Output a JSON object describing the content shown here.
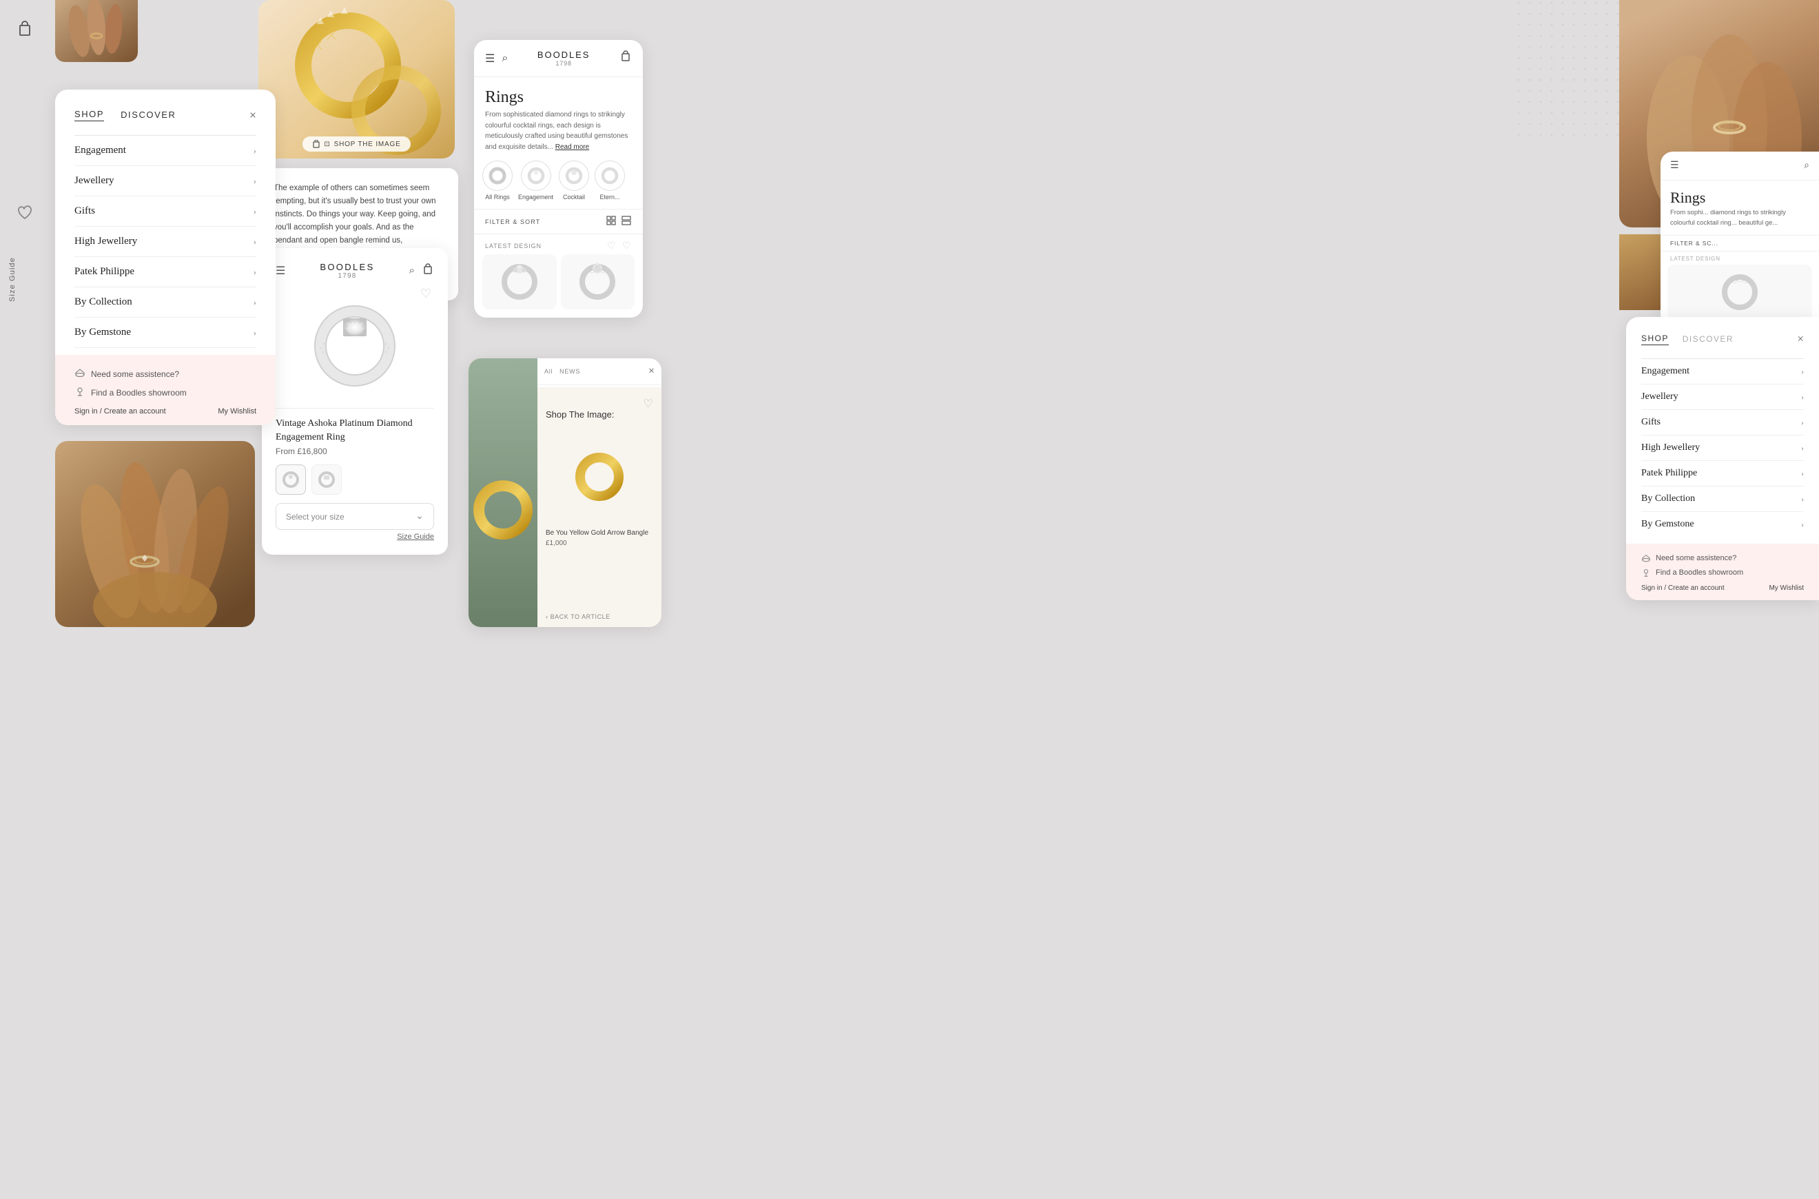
{
  "brand": {
    "name": "BOODLES",
    "year": "1798"
  },
  "nav": {
    "shop_label": "SHOP",
    "discover_label": "DISCOVER",
    "close_label": "×",
    "items": [
      {
        "label": "Engagement",
        "id": "engagement"
      },
      {
        "label": "Jewellery",
        "id": "jewellery"
      },
      {
        "label": "Gifts",
        "id": "gifts"
      },
      {
        "label": "High Jewellery",
        "id": "high-jewellery"
      },
      {
        "label": "Patek Philippe",
        "id": "patek-philippe"
      },
      {
        "label": "By Collection",
        "id": "by-collection"
      },
      {
        "label": "By Gemstone",
        "id": "by-gemstone"
      }
    ],
    "footer": {
      "assistance": "Need some assistence?",
      "showroom": "Find a Boodles showroom",
      "sign_in": "Sign in / Create an account",
      "wishlist": "My Wishlist"
    }
  },
  "nav2": {
    "shop_label": "SHOP",
    "discover_label": "DISCOVER",
    "close_label": "×",
    "items": [
      {
        "label": "Engagement"
      },
      {
        "label": "Jewellery"
      },
      {
        "label": "Gifts"
      },
      {
        "label": "High Jewellery"
      },
      {
        "label": "Patek Philippe"
      },
      {
        "label": "By Collection"
      },
      {
        "label": "By Gemstone"
      }
    ],
    "footer": {
      "assistance": "Need some assistence?",
      "showroom": "Find a Boodles showroom",
      "sign_in": "Sign in / Create an account",
      "wishlist": "My Wishlist"
    }
  },
  "rings_page": {
    "heading": "Rings",
    "description": "From sophisticated diamond rings to strikingly colourful cocktail rings, each design is meticulously crafted using beautiful gemstones and exquisite details...",
    "read_more": "Read more",
    "filter_label": "FILTER & SORT",
    "latest_design_label": "LATEST DESIGN",
    "ring_types": [
      {
        "label": "All Rings"
      },
      {
        "label": "Engagement"
      },
      {
        "label": "Cocktail"
      },
      {
        "label": "Etern..."
      }
    ]
  },
  "product": {
    "name": "Vintage Ashoka Platinum Diamond\nEngagement Ring",
    "price": "From £16,800",
    "size_placeholder": "Select your size",
    "size_guide": "Size Guide"
  },
  "article": {
    "back_label": "‹ BACK TO ARTICLE",
    "body": "The example of others can sometimes seem tempting, but it's usually best to trust your own instincts. Do things your way. Keep going, and you'll accomplish your goals. And as the pendant and open bangle remind us, sometimes we might need to pivot. That's fine; there's nothing wrong with a determined volte-face. In fact, it might be the whole point."
  },
  "shop_image": {
    "label": "Shop The Image:",
    "bangle_name": "Be You Yellow Gold Arrow Bangle",
    "bangle_price": "£1,000",
    "back_link": "‹ BACK TO ARTICLE"
  },
  "icons": {
    "menu": "☰",
    "search": "⌕",
    "cart": "🛍",
    "cart2": "⊡",
    "heart": "♡",
    "chevron": "›",
    "back_arrow": "‹",
    "close": "×",
    "grid": "⊞",
    "list": "☰",
    "hat": "🎩",
    "pin": "📍",
    "location_pin": "⊙"
  },
  "size_guide": "Size Guide"
}
